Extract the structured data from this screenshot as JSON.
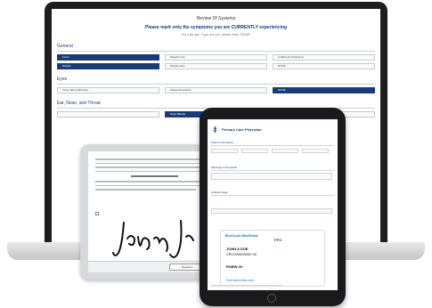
{
  "laptop": {
    "title": "Review Of Systems",
    "subtitle": "Please mark only the symptoms you are CURRENTLY experiencing",
    "hint": "Not a list ago, if you are you, please mark \"NONE\"",
    "sections": [
      {
        "label": "General",
        "rows": [
          [
            {
              "text": "Fever",
              "selected": true
            },
            {
              "text": "Weight Loss",
              "selected": false
            },
            {
              "text": "Cold/Heat Intolerance",
              "selected": false
            }
          ],
          [
            {
              "text": "Weight",
              "selected": true
            },
            {
              "text": "Weight Gain",
              "selected": false
            },
            {
              "text": "NONE",
              "selected": false
            }
          ]
        ]
      },
      {
        "label": "Eyes",
        "rows": [
          [
            {
              "text": "Vision Blurred/Double",
              "selected": false
            },
            {
              "text": "Glasses/Contacts",
              "selected": false
            },
            {
              "text": "NONE",
              "selected": true
            }
          ]
        ]
      },
      {
        "label": "Ear, Nose, and Throat",
        "rows": [
          [
            {
              "text": "",
              "selected": false
            },
            {
              "text": "Nose Bleeds",
              "selected": true
            },
            {
              "text": "",
              "selected": false
            }
          ]
        ]
      }
    ]
  },
  "consent": {
    "button": "Signature"
  },
  "intake": {
    "title": "Primary Care Physician",
    "section_patient": "Patient Information",
    "section_message": "Message to Physician",
    "section_upload": "Upload Image",
    "card": {
      "brand": "BlueCross BlueShield",
      "ppo": "PPO",
      "name": "JOHN A DOE",
      "id": "YRC000000000 00",
      "rx": "RXBIN 00",
      "bottom": "Visit www.bcbs.com"
    }
  },
  "colors": {
    "accent": "#1b3b77",
    "device": "#1a1a1c"
  }
}
